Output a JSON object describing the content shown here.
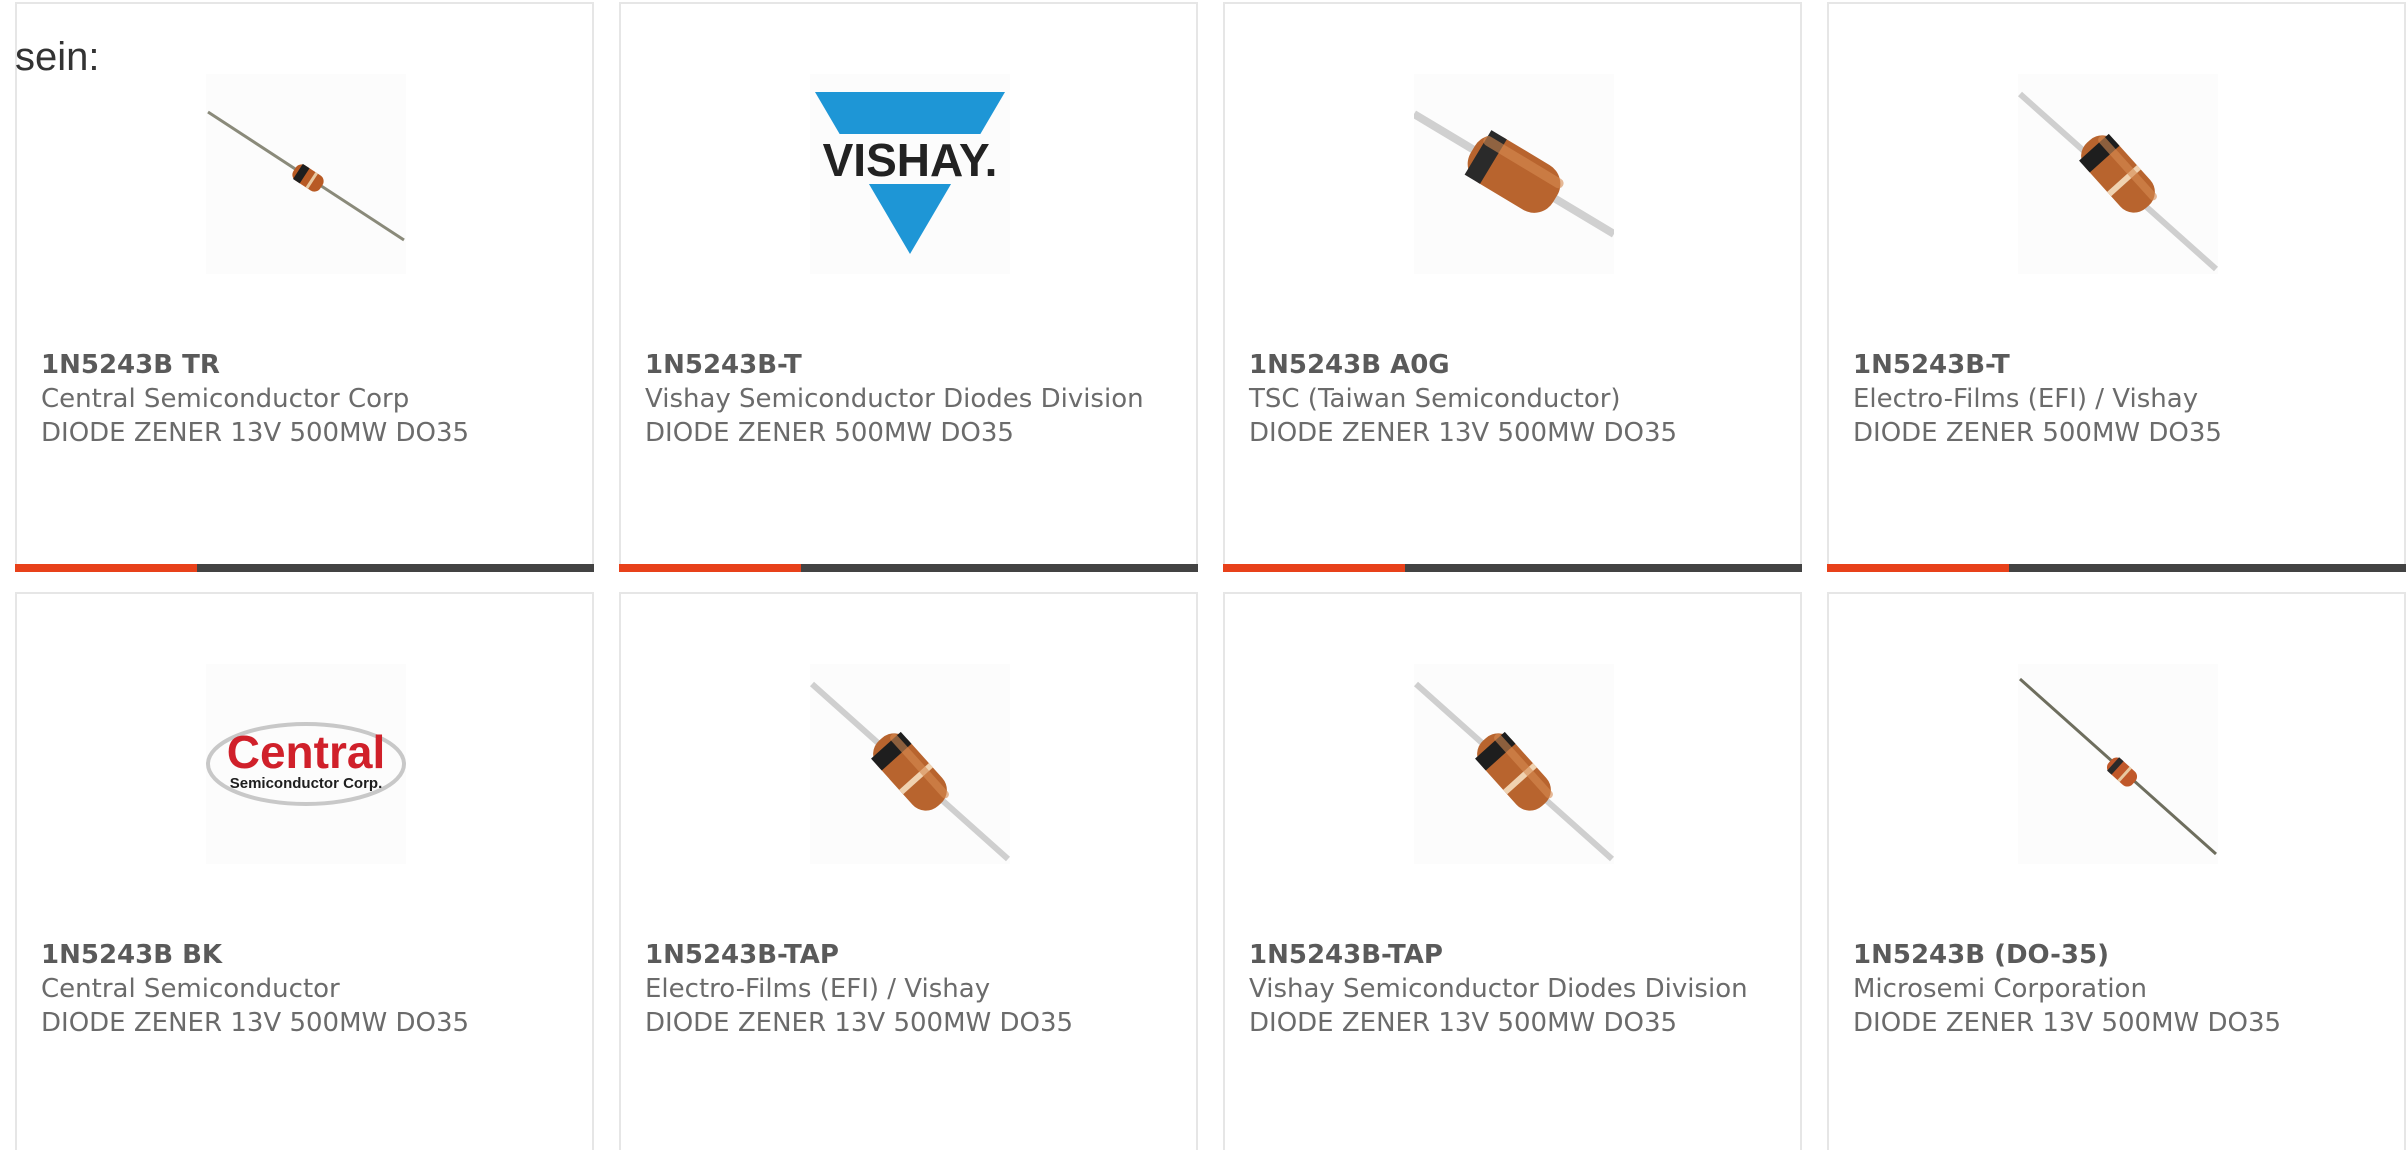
{
  "intro_text": "sein:",
  "colors": {
    "accent": "#e8411a",
    "bar": "#434343",
    "border": "#e6e6e6",
    "text": "#6b6b6b"
  },
  "products": [
    {
      "part": "1N5243B TR",
      "manufacturer": "Central Semiconductor Corp",
      "description": "DIODE ZENER 13V 500MW DO35",
      "image": "axial-diode-thin-icon"
    },
    {
      "part": "1N5243B-T",
      "manufacturer": "Vishay Semiconductor Diodes Division",
      "description": "DIODE ZENER 500MW DO35",
      "image": "vishay-logo",
      "logo_text": "VISHAY."
    },
    {
      "part": "1N5243B A0G",
      "manufacturer": "TSC (Taiwan Semiconductor)",
      "description": "DIODE ZENER 13V 500MW DO35",
      "image": "axial-diode-large-icon"
    },
    {
      "part": "1N5243B-T",
      "manufacturer": "Electro-Films (EFI) / Vishay",
      "description": "DIODE ZENER 500MW DO35",
      "image": "axial-diode-icon"
    },
    {
      "part": "1N5243B BK",
      "manufacturer": "Central Semiconductor",
      "description": "DIODE ZENER 13V 500MW DO35",
      "image": "central-semiconductor-logo",
      "logo_text": "Central",
      "logo_subtext": "Semiconductor Corp."
    },
    {
      "part": "1N5243B-TAP",
      "manufacturer": "Electro-Films (EFI) / Vishay",
      "description": "DIODE ZENER 13V 500MW DO35",
      "image": "axial-diode-icon"
    },
    {
      "part": "1N5243B-TAP",
      "manufacturer": "Vishay Semiconductor Diodes Division",
      "description": "DIODE ZENER 13V 500MW DO35",
      "image": "axial-diode-icon"
    },
    {
      "part": "1N5243B (DO-35)",
      "manufacturer": "Microsemi Corporation",
      "description": "DIODE ZENER 13V 500MW DO35",
      "image": "axial-diode-thin-icon"
    }
  ]
}
